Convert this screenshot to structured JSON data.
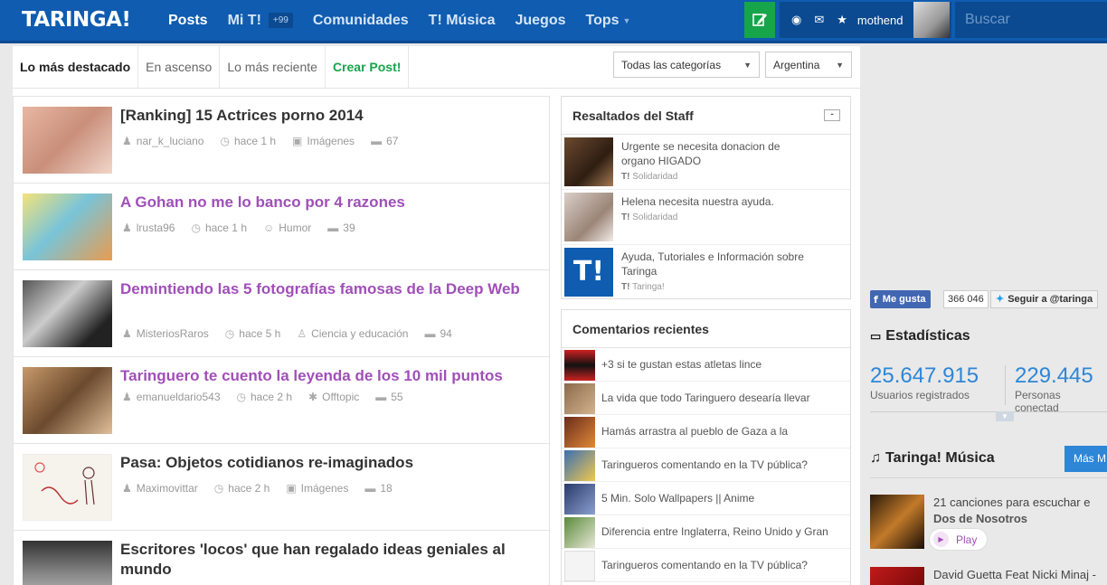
{
  "header": {
    "logo": "TARINGA!",
    "nav": [
      {
        "label": "Posts",
        "active": true
      },
      {
        "label": "Mi T!",
        "badge": "+99"
      },
      {
        "label": "Comunidades"
      },
      {
        "label": "T! Música"
      },
      {
        "label": "Juegos"
      },
      {
        "label": "Tops"
      }
    ],
    "username": "mothend",
    "search_placeholder": "Buscar",
    "icons": [
      "compose-icon",
      "eye-icon",
      "mail-icon",
      "star-icon"
    ]
  },
  "tabs": [
    {
      "label": "Lo más destacado",
      "active": true
    },
    {
      "label": "En ascenso"
    },
    {
      "label": "Lo más reciente"
    },
    {
      "label": "Crear Post!"
    }
  ],
  "filters": {
    "category": "Todas las categorías",
    "country": "Argentina"
  },
  "posts": [
    {
      "title": "[Ranking] 15 Actrices porno 2014",
      "author": "nar_k_luciano",
      "time": "hace 1 h",
      "category": "Imágenes",
      "comments": "67",
      "visited": false
    },
    {
      "title": "A Gohan no me lo banco por 4 razones",
      "author": "lrusta96",
      "time": "hace 1 h",
      "category": "Humor",
      "comments": "39",
      "visited": true
    },
    {
      "title": "Demintiendo las 5 fotografías famosas de la Deep Web",
      "author": "MisteriosRaros",
      "time": "hace 5 h",
      "category": "Ciencia y educación",
      "comments": "94",
      "visited": true
    },
    {
      "title": "Taringuero te cuento la leyenda de los 10 mil puntos",
      "author": "emanueldario543",
      "time": "hace 2 h",
      "category": "Offtopic",
      "comments": "55",
      "visited": true
    },
    {
      "title": "Pasa: Objetos cotidianos re-imaginados",
      "author": "Maximovittar",
      "time": "hace 2 h",
      "category": "Imágenes",
      "comments": "18",
      "visited": false
    },
    {
      "title": "Escritores 'locos' que han regalado ideas geniales al mundo",
      "visited": false
    }
  ],
  "staff": {
    "title": "Resaltados del Staff",
    "collapse_label": "-",
    "items": [
      {
        "text": "Urgente se necesita donacion de organo HIGADO",
        "category": "Solidaridad"
      },
      {
        "text": "Helena necesita nuestra ayuda.",
        "category": "Solidaridad"
      },
      {
        "text": "Ayuda, Tutoriales e Información sobre Taringa",
        "category": "Taringa!"
      }
    ]
  },
  "comments": {
    "title": "Comentarios recientes",
    "items": [
      "+3 si te gustan estas atletas lince",
      "La vida que todo Taringuero desearía llevar",
      "Hamás arrastra al pueblo de Gaza a la",
      "Taringueros comentando en la TV pública?",
      "5 Min. Solo Wallpapers || Anime",
      "Diferencia entre Inglaterra, Reino Unido y Gran",
      "Taringueros comentando en la TV pública?"
    ]
  },
  "social": {
    "fb_label": "Me gusta",
    "fb_count": "366 046",
    "tw_label": "Seguir a @taringa"
  },
  "stats": {
    "title": "Estadísticas",
    "users_value": "25.647.915",
    "users_label": "Usuarios registrados",
    "online_value": "229.445",
    "online_label": "Personas conectad"
  },
  "music": {
    "title": "Taringa! Música",
    "more_label": "Más M",
    "items": [
      {
        "text": "21 canciones para escuchar e",
        "artist": "Dos de Nosotros",
        "play_label": "Play"
      },
      {
        "text": "David Guetta Feat Nicki Minaj -"
      }
    ]
  }
}
